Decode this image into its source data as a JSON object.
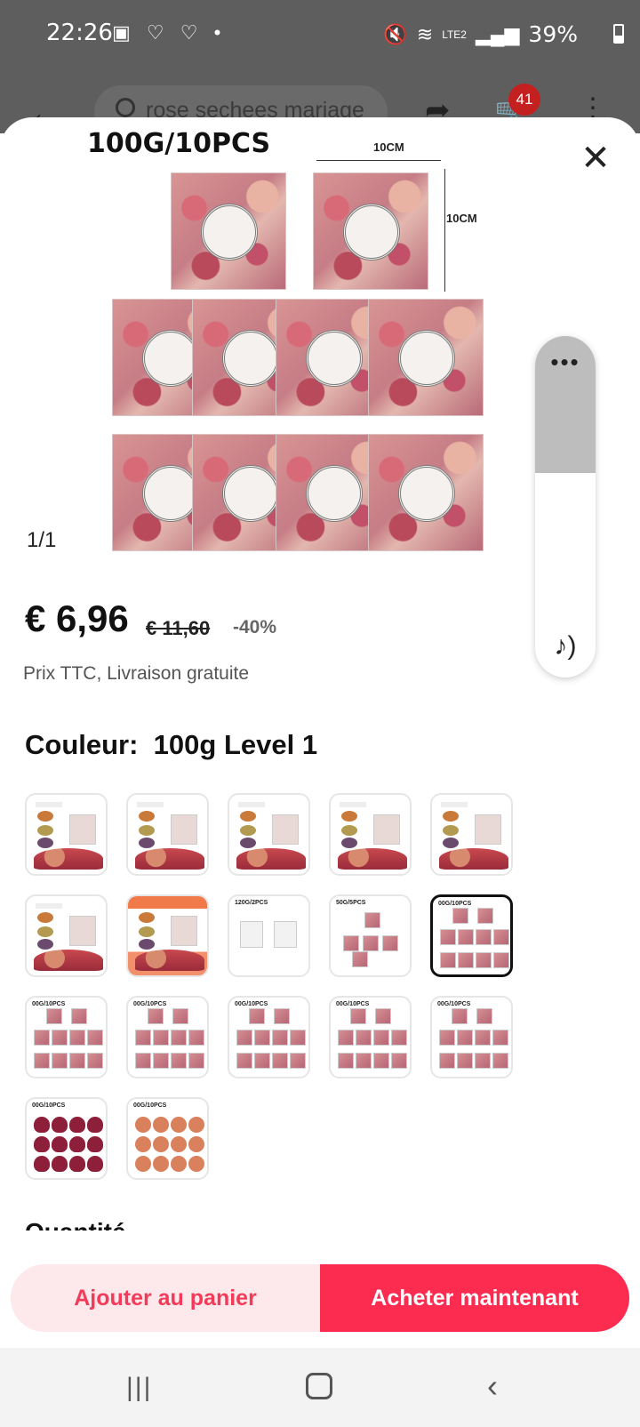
{
  "status_bar": {
    "time": "22:26",
    "notifications": "▣ ♡ ♡ •",
    "battery": "39%",
    "network": "LTE2"
  },
  "app_bar": {
    "search_text": "rose sechees mariage",
    "cart_count": "41"
  },
  "product": {
    "image_title": "100G/10PCS",
    "dim_top": "10CM",
    "dim_side": "10CM",
    "image_counter": "1/1",
    "price": "€ 6,96",
    "old_price": "€ 11,60",
    "discount": "-40%",
    "tax_note": "Prix TTC, Livraison gratuite",
    "color_label": "Couleur:",
    "color_value": "100g Level 1"
  },
  "swatches": [
    {
      "type": "bag",
      "label": ""
    },
    {
      "type": "bag",
      "label": ""
    },
    {
      "type": "bag",
      "label": ""
    },
    {
      "type": "bag",
      "label": ""
    },
    {
      "type": "bag",
      "label": ""
    },
    {
      "type": "bag",
      "label": ""
    },
    {
      "type": "promo",
      "label": ""
    },
    {
      "type": "grid2",
      "label": "120G/2PCS"
    },
    {
      "type": "grid5",
      "label": "50G/5PCS"
    },
    {
      "type": "grid10",
      "label": "00G/10PCS",
      "selected": true
    },
    {
      "type": "grid10",
      "label": "00G/10PCS"
    },
    {
      "type": "grid10",
      "label": "00G/10PCS"
    },
    {
      "type": "grid10",
      "label": "00G/10PCS"
    },
    {
      "type": "grid10",
      "label": "00G/10PCS"
    },
    {
      "type": "grid10",
      "label": "00G/10PCS"
    },
    {
      "type": "heart",
      "label": "00G/10PCS"
    },
    {
      "type": "orange",
      "label": "00G/10PCS"
    }
  ],
  "section_peek": "Quantité",
  "actions": {
    "add_to_cart": "Ajouter au panier",
    "buy_now": "Acheter maintenant"
  },
  "colors": {
    "accent": "#fb2c50",
    "accent_light": "#fde9ec",
    "badge": "#c52020"
  }
}
